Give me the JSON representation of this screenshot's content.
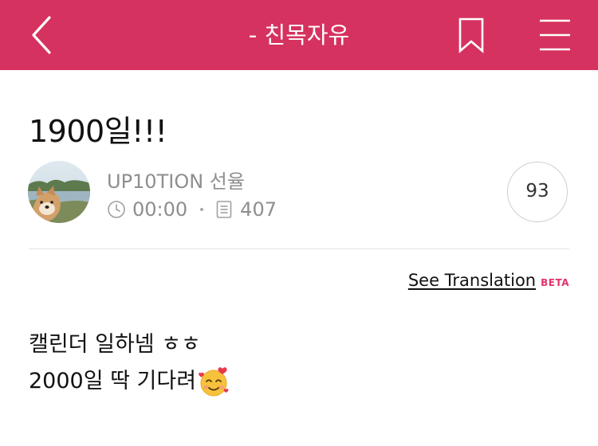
{
  "header": {
    "title": "- 친목자유",
    "background": "#d6325f",
    "back_icon": "chevron-left-icon",
    "bookmark_icon": "bookmark-icon",
    "menu_icon": "hamburger-menu-icon"
  },
  "post": {
    "title": "1900일!!!",
    "author": "UP10TION 선율",
    "time": "00:00",
    "views": "407",
    "comment_count": "93",
    "translate_label": "See Translation",
    "translate_badge": "BETA",
    "body_lines": [
      "캘린더 일하넴 ㅎㅎ",
      "2000일 딱 기다려"
    ],
    "emoji": "smiling-face-with-hearts-emoji"
  }
}
